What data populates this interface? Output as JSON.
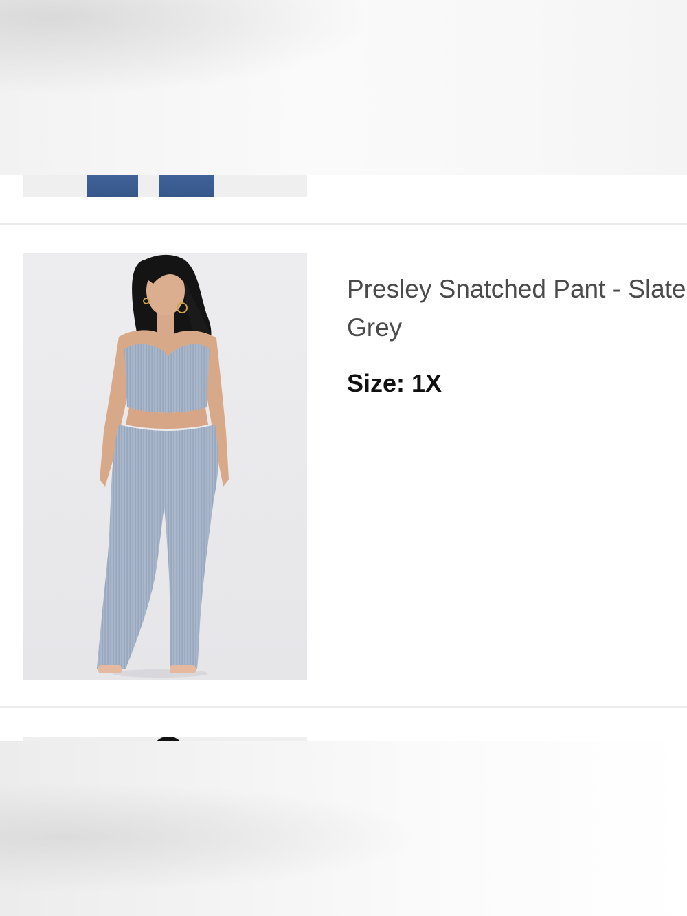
{
  "cart_items": {
    "current": {
      "title": "Presley Snatched Pant - Slate Grey",
      "size_label": "Size: 1X",
      "image_icon": "product-photo",
      "fabric_color": "#a9b6cb"
    }
  },
  "colors": {
    "divider": "#ececec",
    "title_text": "#4a4a4a",
    "size_text": "#111111",
    "image_background": "#ececee"
  }
}
